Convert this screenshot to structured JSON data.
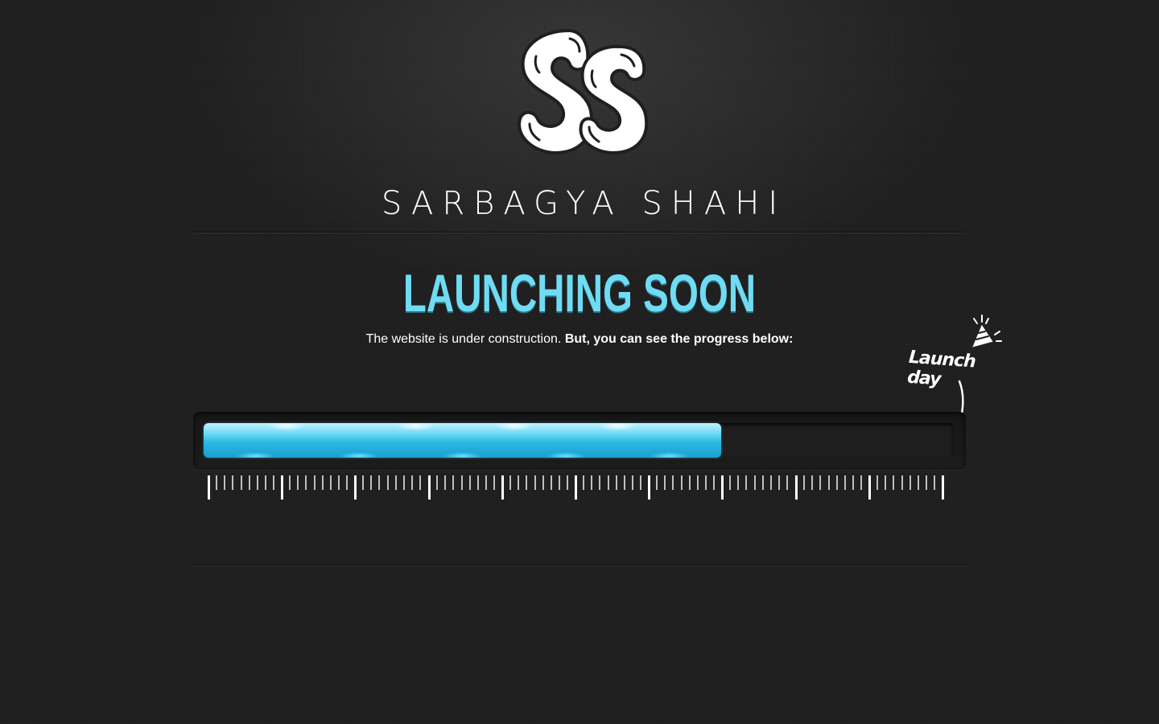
{
  "brand": {
    "logo_text": "SS",
    "site_name": "SARBAGYA SHAHI"
  },
  "main": {
    "heading": "LAUNCHING SOON",
    "subtitle_plain": "The website is under construction.",
    "subtitle_bold": "But, you can see the progress below:"
  },
  "progress": {
    "fraction": 0.69,
    "launch_label": "Launch day",
    "launch_icon": "party-hat-icon",
    "arrow_icon": "arrow-down-icon",
    "major_ticks": 11,
    "minor_per_segment": 8
  },
  "colors": {
    "accent": "#6fdcf3",
    "bar_fill": "#2cb9e4",
    "background": "#1f1f1f"
  }
}
